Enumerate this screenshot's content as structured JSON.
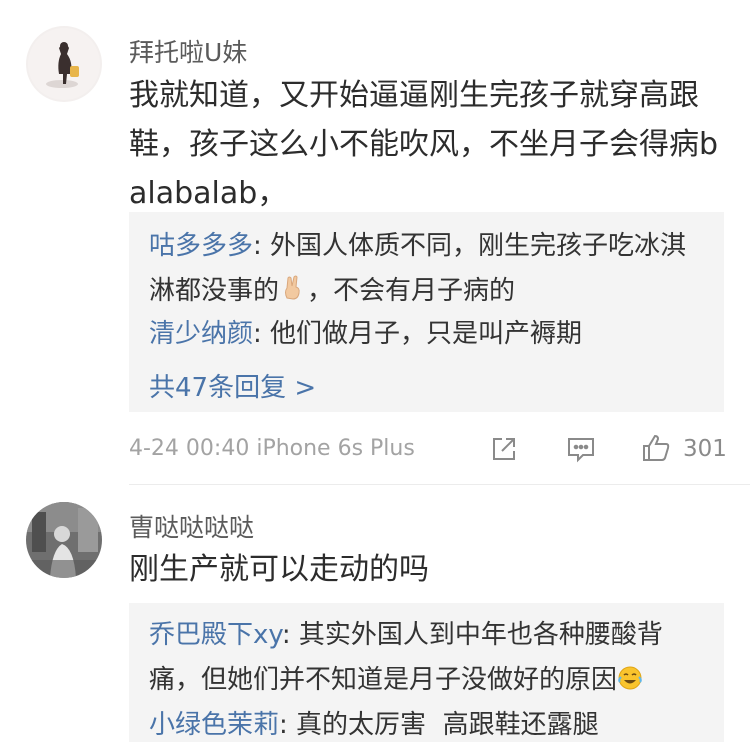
{
  "comments": [
    {
      "username": "拜托啦U妹",
      "text": "我就知道，又开始逼逼刚生完孩子就穿高跟鞋，孩子这么小不能吹风，不坐月子会得病balabalab，",
      "replies": [
        {
          "name": "咕多多多",
          "sep": ": ",
          "text_before": "外国人体质不同，刚生完孩子吃冰淇淋都没事的",
          "emoji": "victory-hand-emoji",
          "text_after": "，不会有月子病的"
        },
        {
          "name": "清少纳颜",
          "sep": ": ",
          "text": "他们做月子，只是叫产褥期"
        }
      ],
      "more_replies": "共47条回复 >",
      "timestamp": "4-24 00:40",
      "device": "iPhone 6s Plus",
      "like_count": "301"
    },
    {
      "username": "曺哒哒哒哒",
      "text": "刚生产就可以走动的吗",
      "replies": [
        {
          "name": "乔巴殿下xy",
          "sep": ": ",
          "text_before": "其实外国人到中年也各种腰酸背痛，但她们并不知道是月子没做好的原因",
          "emoji": "tears-of-joy-emoji",
          "text_after": ""
        },
        {
          "name": "小绿色茉莉",
          "sep": ": ",
          "text": "真的太厉害  高跟鞋还露腿"
        }
      ]
    }
  ],
  "colors": {
    "username": "#5b5b5b",
    "reply_name": "#4a74a9",
    "reply_bg": "#f4f4f4",
    "meta": "#a3a3a3"
  },
  "icons": [
    "share-icon",
    "comment-icon",
    "thumbs-up-icon"
  ]
}
